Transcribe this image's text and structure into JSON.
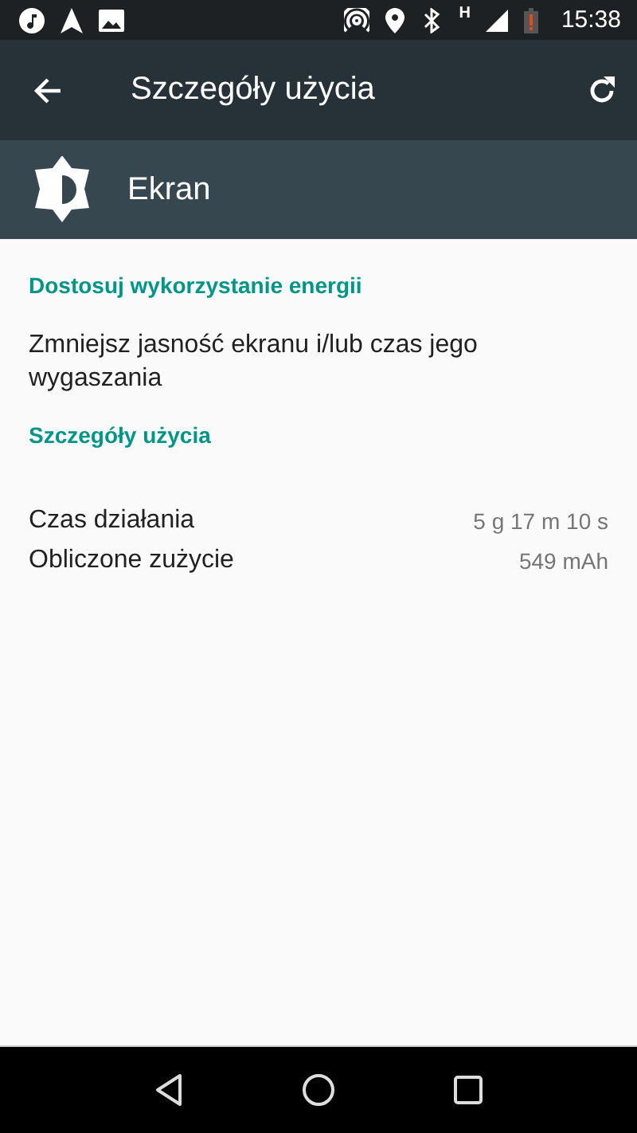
{
  "status_bar": {
    "time": "15:38",
    "network": "H"
  },
  "toolbar": {
    "title": "Szczegóły użycia"
  },
  "app_header": {
    "name": "Ekran"
  },
  "sections": [
    {
      "title": "Dostosuj wykorzystanie energii",
      "items": [
        {
          "kind": "action",
          "text": "Zmniejsz jasność ekranu i/lub czas jego wygaszania"
        }
      ]
    },
    {
      "title": "Szczegóły użycia",
      "items": [
        {
          "kind": "stat",
          "label": "Czas działania",
          "value": "5 g 17 m 10 s"
        },
        {
          "kind": "stat",
          "label": "Obliczone zużycie",
          "value": "549 mAh"
        }
      ]
    }
  ]
}
